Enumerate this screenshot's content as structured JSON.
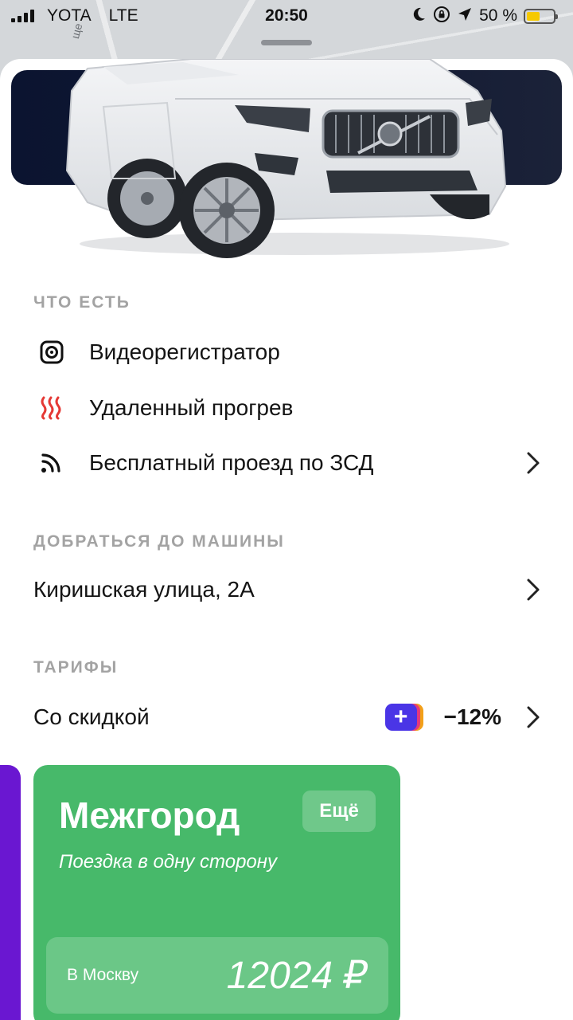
{
  "status_bar": {
    "carrier": "YOTA",
    "network": "LTE",
    "time": "20:50",
    "battery_percent": "50 %",
    "battery_level": 0.5,
    "icons": [
      "moon-icon",
      "rotation-lock-icon",
      "location-arrow-icon"
    ]
  },
  "map": {
    "street_fragment": "ще"
  },
  "features": {
    "title": "ЧТО ЕСТЬ",
    "items": [
      {
        "label": "Видеорегистратор",
        "icon": "dashcam-icon"
      },
      {
        "label": "Удаленный прогрев",
        "icon": "heating-icon",
        "icon_color": "#e53935"
      },
      {
        "label": "Бесплатный проезд по ЗСД",
        "icon": "transponder-icon"
      }
    ]
  },
  "get_to_car": {
    "title": "ДОБРАТЬСЯ ДО МАШИНЫ",
    "address": "Киришская улица, 2А"
  },
  "tariffs": {
    "title": "ТАРИФЫ",
    "row_label": "Со скидкой",
    "plus_badge": "+",
    "discount": "−12%",
    "card": {
      "title": "Межгород",
      "more_label": "Ещё",
      "subtitle": "Поездка в одну сторону",
      "destination": "В Москву",
      "price": "12024 ₽",
      "color": "#47b96a"
    },
    "next_card_color": "#6a17d1"
  }
}
